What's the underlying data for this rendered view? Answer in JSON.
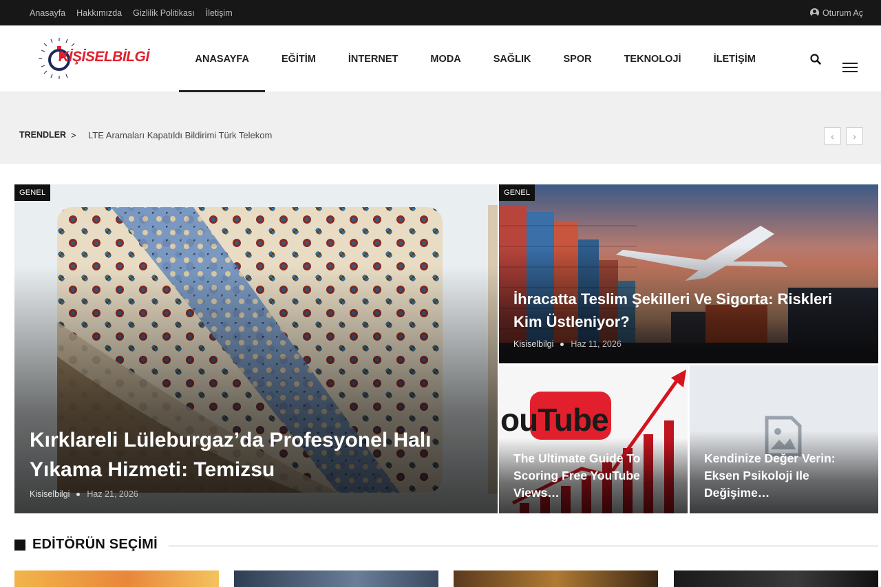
{
  "topbar": {
    "links": [
      "Anasayfa",
      "Hakkımızda",
      "Gizlilik Politikası",
      "İletişim"
    ],
    "login_label": "Oturum Aç"
  },
  "header": {
    "logo_text": "KİŞİSELBİLGİ",
    "nav": [
      "ANASAYFA",
      "EĞİTİM",
      "İNTERNET",
      "MODA",
      "SAĞLIK",
      "SPOR",
      "TEKNOLOJİ",
      "İLETİŞİM"
    ],
    "active_nav": "ANASAYFA"
  },
  "trending": {
    "label": "TRENDLER",
    "separator": ">",
    "headline": "LTE Aramaları Kapatıldı Bildirimi Türk Telekom",
    "prev": "‹",
    "next": "›"
  },
  "featured": {
    "main": {
      "badge": "GENEL",
      "title": "Kırklareli Lüleburgaz’da Profesyonel Halı Yıkama Hizmeti: Temizsu",
      "author": "Kisiselbilgi",
      "date": "Haz 21, 2026"
    },
    "top_right": {
      "badge": "GENEL",
      "title": "İhracatta Teslim Şekilleri Ve Sigorta: Riskleri Kim Üstleniyor?",
      "author": "Kisiselbilgi",
      "date": "Haz 11, 2026"
    },
    "bottom_left": {
      "title": "The Ultimate Guide To Scoring Free YouTube Views…",
      "image_text": "ouTube"
    },
    "bottom_right": {
      "title": "Kendinize Değer Verin: Eksen Psikoloji Ile Değişime…"
    }
  },
  "editors": {
    "heading": "EDİTÖRÜN SEÇİMİ"
  },
  "colors": {
    "topbar_bg": "#171717",
    "brand_red": "#e2202d",
    "trending_bg": "#f0f0f0",
    "badge_bg": "#111111"
  }
}
